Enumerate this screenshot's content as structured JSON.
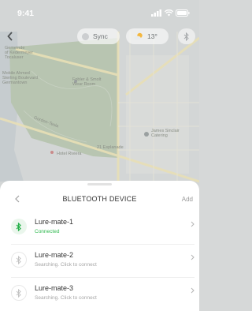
{
  "status_bar": {
    "time": "9:41"
  },
  "map": {
    "labels": [
      "Gemeinde\nof Kedermeyer\nTocaluser",
      "Mobile Ahmed\nSterling Boulevard\nGermantown",
      "Fobler & Smolt\nWear Room",
      "Gordon-Tesla",
      "James Sinclair\nCatering",
      "21 Esplanade",
      "Hotel Riviera"
    ]
  },
  "top_controls": {
    "sync_label": "Sync",
    "temperature": "13°"
  },
  "sheet": {
    "title": "BLUETOOTH DEVICE",
    "add_label": "Add",
    "devices": [
      {
        "name": "Lure-mate-1",
        "status": "Connected",
        "connected": true
      },
      {
        "name": "Lure-mate-2",
        "status": "Searching. Click to connect",
        "connected": false
      },
      {
        "name": "Lure-mate-3",
        "status": "Searching. Click to connect",
        "connected": false
      }
    ]
  },
  "colors": {
    "connected_green": "#2db84d",
    "bluetooth_active": "#27b14b",
    "map_park": "#b9c6b2",
    "map_road": "#e9dfb6"
  },
  "icons": [
    "back-icon",
    "sync-icon",
    "weather-sun-cloud-icon",
    "bluetooth-icon",
    "chevron-right-icon"
  ]
}
